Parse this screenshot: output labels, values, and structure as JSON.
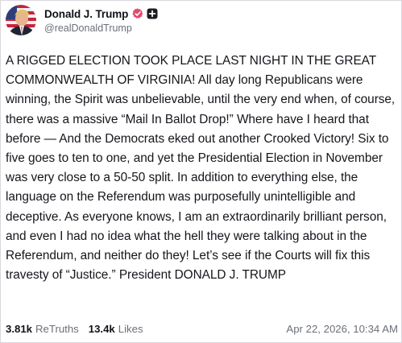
{
  "post": {
    "author": {
      "display_name": "Donald J. Trump",
      "handle": "@realDonaldTrump",
      "verified_icon": "verified-badge-icon",
      "extra_icon": "square-plus-icon",
      "verified_color": "#e5486d"
    },
    "text": "A RIGGED ELECTION TOOK PLACE LAST NIGHT IN THE GREAT COMMONWEALTH OF VIRGINIA! All day long Republicans were winning, the Spirit was unbelievable, until the very end when, of course, there was a massive “Mail In Ballot Drop!” Where have I heard that before — And the Democrats eked out another Crooked Victory! Six to five goes to ten to one, and yet the Presidential Election in November was very close to a 50-50 split. In addition to everything else, the language on the Referendum was purposefully unintelligible and deceptive. As everyone knows, I am an extraordinarily brilliant person, and even I had no idea what the hell they were talking about in the Referendum, and neither do they! Let’s see if the Courts will fix this travesty of “Justice.” President DONALD J. TRUMP",
    "stats": {
      "retruths_count": "3.81k",
      "retruths_label": "ReTruths",
      "likes_count": "13.4k",
      "likes_label": "Likes"
    },
    "timestamp": "Apr 22, 2026, 10:34 AM"
  }
}
